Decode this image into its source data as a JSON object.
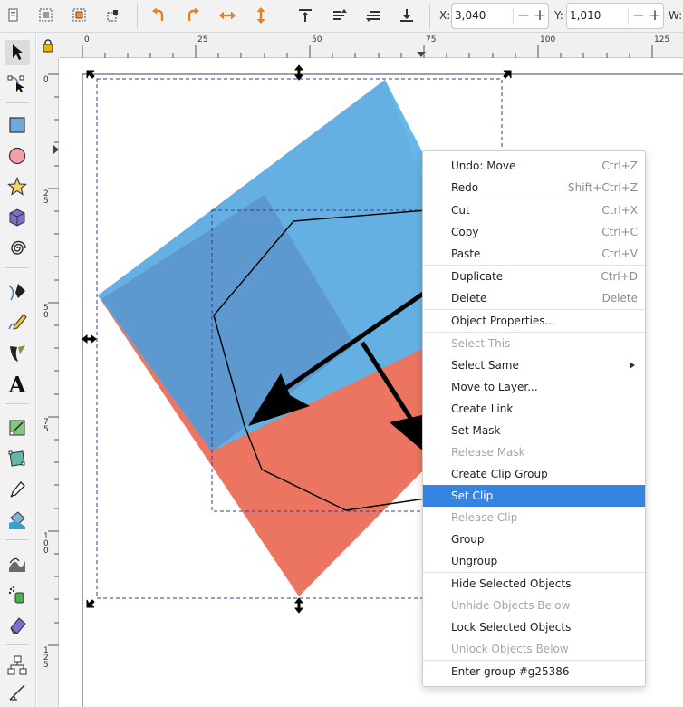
{
  "toolbar": {
    "x_label": "X:",
    "x_value": "3,040",
    "y_label": "Y:",
    "y_value": "1,010",
    "w_label": "W:",
    "minus": "−",
    "plus": "+",
    "icons": [
      "select-all-icon",
      "select-all-layers-icon",
      "deselect-icon",
      "touch-select-icon",
      "rotate-ccw-icon",
      "rotate-cw-icon",
      "flip-horizontal-icon",
      "flip-vertical-icon",
      "raise-to-top-icon",
      "raise-icon",
      "lower-icon",
      "lower-to-bottom-icon"
    ]
  },
  "ruler": {
    "top": [
      "0",
      "25",
      "50",
      "75",
      "100",
      "125"
    ],
    "left": [
      "0",
      "25",
      "50",
      "75",
      "100",
      "125"
    ]
  },
  "tools": [
    "selector-tool",
    "node-tool",
    "rectangle-tool",
    "ellipse-tool",
    "star-tool",
    "box3d-tool",
    "spiral-tool",
    "pen-tool",
    "pencil-tool",
    "calligraphy-tool",
    "text-tool",
    "gradient-tool",
    "mesh-tool",
    "dropper-tool",
    "paint-bucket-tool",
    "tweak-tool",
    "spray-tool",
    "eraser-tool",
    "connector-tool",
    "measure-tool"
  ],
  "text_tool_glyph": "A",
  "colors": {
    "blue_shape": "#4aa8e6",
    "red_shape": "#ec7561",
    "highlight": "#3584e4",
    "selection_dash": "#3a3a8c"
  },
  "context_menu": {
    "items": [
      {
        "label": "Undo: Move",
        "accel": "Ctrl+Z"
      },
      {
        "label": "Redo",
        "accel": "Shift+Ctrl+Z"
      },
      {
        "label": "Cut",
        "accel": "Ctrl+X"
      },
      {
        "label": "Copy",
        "accel": "Ctrl+C"
      },
      {
        "label": "Paste",
        "accel": "Ctrl+V"
      },
      {
        "label": "Duplicate",
        "accel": "Ctrl+D"
      },
      {
        "label": "Delete",
        "accel": "Delete"
      },
      {
        "label": "Object Properties..."
      },
      {
        "label": "Select This"
      },
      {
        "label": "Select Same"
      },
      {
        "label": "Move to Layer..."
      },
      {
        "label": "Create Link"
      },
      {
        "label": "Set Mask"
      },
      {
        "label": "Release Mask"
      },
      {
        "label": "Create Clip Group"
      },
      {
        "label": "Set Clip"
      },
      {
        "label": "Release Clip"
      },
      {
        "label": "Group"
      },
      {
        "label": "Ungroup"
      },
      {
        "label": "Hide Selected Objects"
      },
      {
        "label": "Unhide Objects Below"
      },
      {
        "label": "Lock Selected Objects"
      },
      {
        "label": "Unlock Objects Below"
      },
      {
        "label": "Enter group #g25386"
      }
    ]
  }
}
